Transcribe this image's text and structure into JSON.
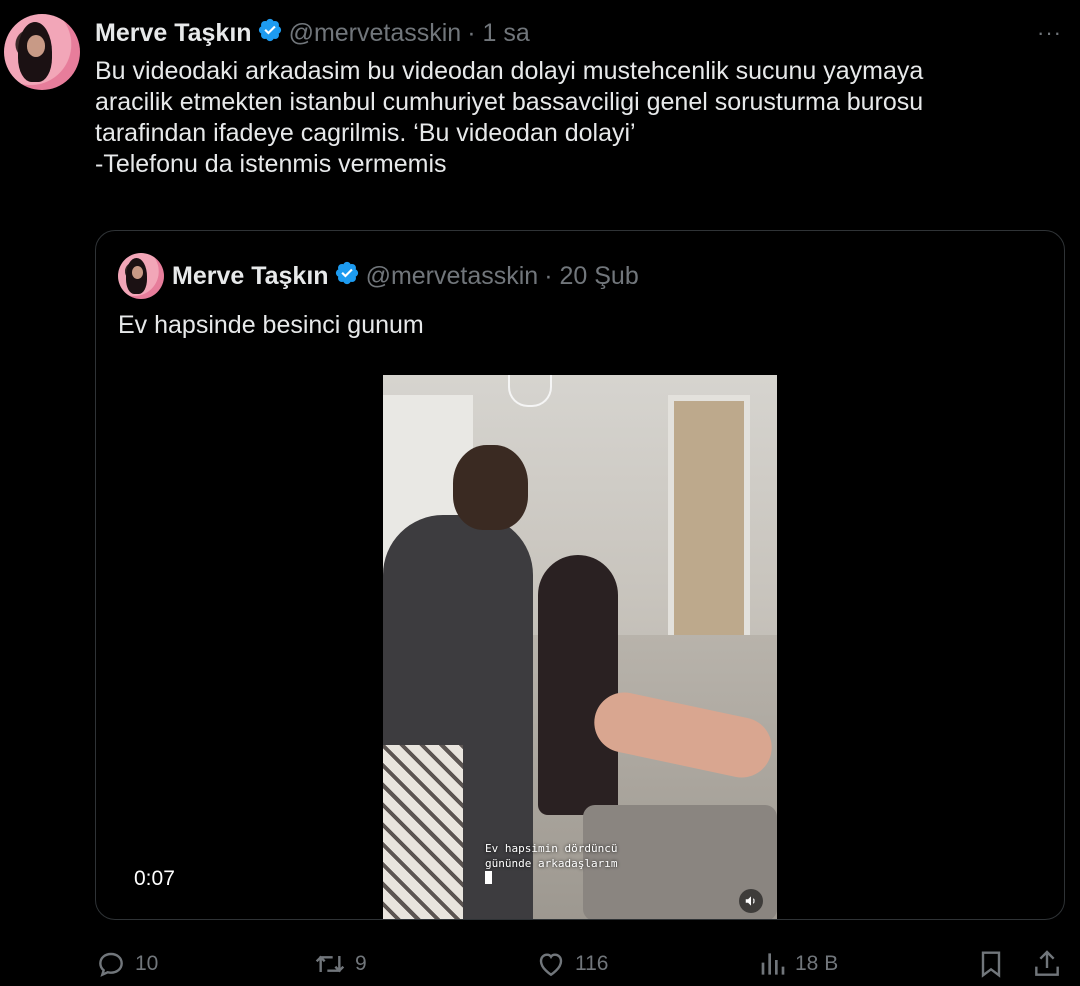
{
  "tweet": {
    "author": {
      "name": "Merve Taşkın",
      "handle": "@mervetasskin",
      "time": "· 1 sa"
    },
    "more_label": "···",
    "text_lines": [
      "Bu videodaki arkadasim bu videodan dolayi mustehcenlik sucunu yaymaya",
      "aracilik etmekten istanbul cumhuriyet bassavciligi genel sorusturma burosu",
      "tarafindan ifadeye cagrilmis. ‘Bu videodan dolayi’",
      "-Telefonu da istenmis vermemis"
    ]
  },
  "quote": {
    "author": {
      "name": "Merve Taşkın",
      "handle": "@mervetasskin",
      "time": "· 20 Şub"
    },
    "text": "Ev hapsinde besinci gunum",
    "video": {
      "caption_lines": [
        "Ev hapsimin dördüncü",
        "gününde arkadaşlarım"
      ],
      "timestamp": "0:07"
    }
  },
  "actions": {
    "replies": "10",
    "retweets": "9",
    "likes": "116",
    "views": "18 B"
  },
  "colors": {
    "background": "#000000",
    "text": "#e7e9ea",
    "muted": "#71767b",
    "verified": "#1d9bf0",
    "border": "#2f3336"
  },
  "icons": [
    "verified-badge-icon",
    "more-icon",
    "reply-icon",
    "retweet-icon",
    "like-icon",
    "views-icon",
    "bookmark-icon",
    "share-icon",
    "mute-icon"
  ]
}
